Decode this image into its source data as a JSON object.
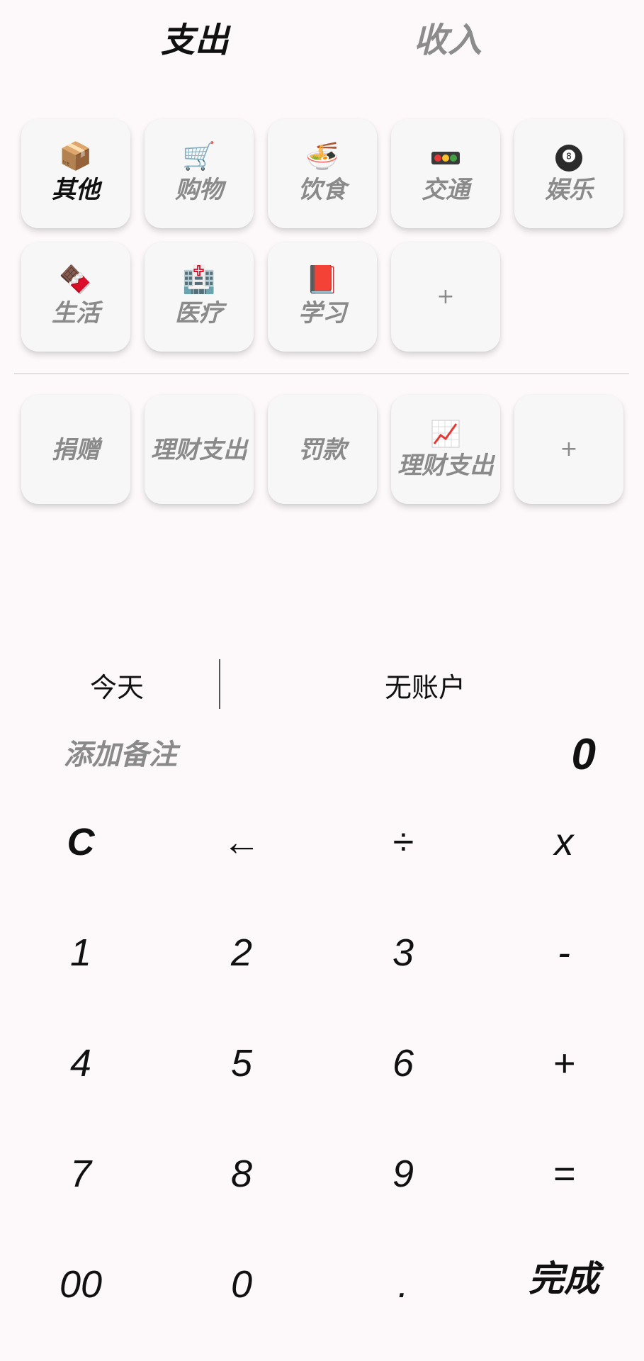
{
  "tabs": {
    "expense": "支出",
    "income": "收入"
  },
  "categories": [
    {
      "label": "其他",
      "icon": "package-icon",
      "emoji": "📦",
      "selected": true
    },
    {
      "label": "购物",
      "icon": "shopping-cart-icon",
      "emoji": "🛒",
      "selected": false
    },
    {
      "label": "饮食",
      "icon": "noodle-bowl-icon",
      "emoji": "🍜",
      "selected": false
    },
    {
      "label": "交通",
      "icon": "traffic-light-icon",
      "emoji": "🚥",
      "selected": false
    },
    {
      "label": "娱乐",
      "icon": "billiard-ball-icon",
      "emoji": "🎱",
      "selected": false
    },
    {
      "label": "生活",
      "icon": "chocolate-bar-icon",
      "emoji": "🍫",
      "selected": false
    },
    {
      "label": "医疗",
      "icon": "hospital-icon",
      "emoji": "🏥",
      "selected": false
    },
    {
      "label": "学习",
      "icon": "book-icon",
      "emoji": "📕",
      "selected": false
    }
  ],
  "add_label": "+",
  "custom_categories": [
    {
      "label": "捐赠"
    },
    {
      "label": "理财支出"
    },
    {
      "label": "罚款"
    },
    {
      "label": "理财支出",
      "icon": "chart-increasing-icon",
      "emoji": "📈"
    }
  ],
  "info": {
    "date": "今天",
    "account": "无账户",
    "note_placeholder": "添加备注",
    "amount": "0"
  },
  "keypad": {
    "rows": [
      [
        "C",
        "←",
        "÷",
        "x"
      ],
      [
        "1",
        "2",
        "3",
        "-"
      ],
      [
        "4",
        "5",
        "6",
        "+"
      ],
      [
        "7",
        "8",
        "9",
        "="
      ],
      [
        "00",
        "0",
        ".",
        "完成"
      ]
    ]
  },
  "colors": {
    "background": "#fdf9fb",
    "card": "#f8f7f8",
    "selected_text": "#111111",
    "muted_text": "#8a8a8a"
  }
}
